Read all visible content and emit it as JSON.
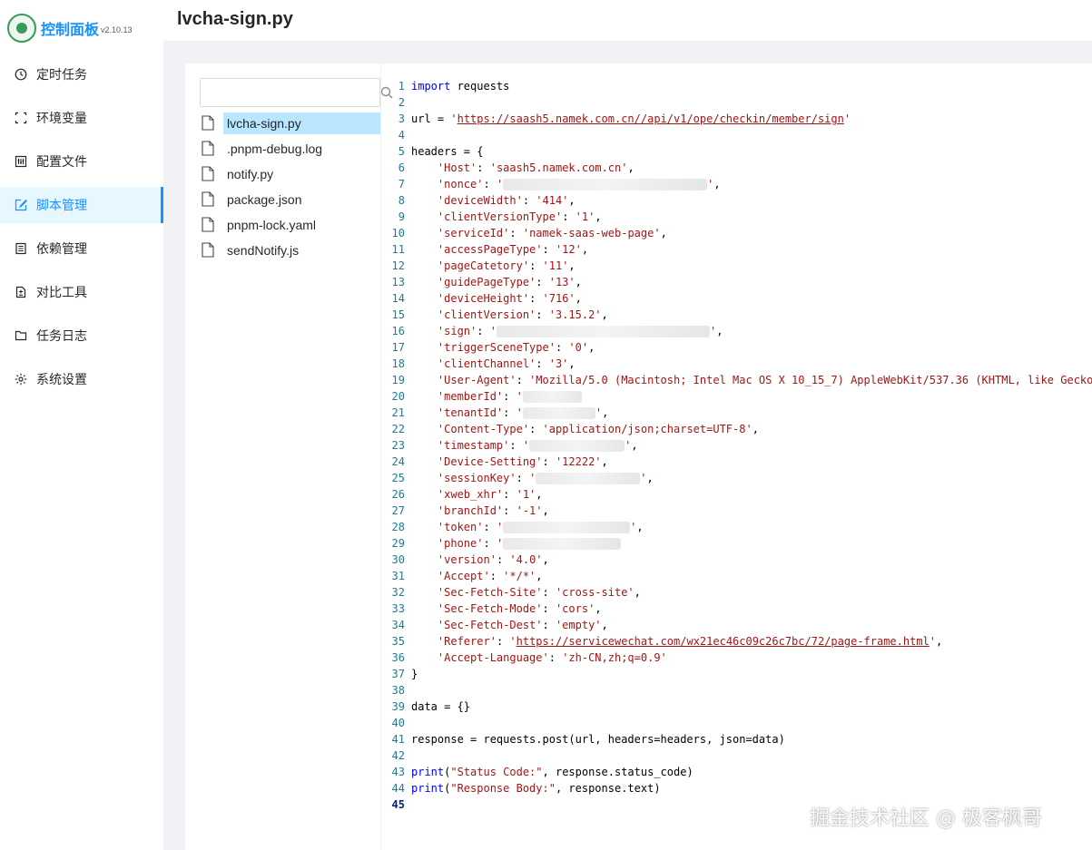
{
  "app": {
    "title": "控制面板",
    "version": "v2.10.13"
  },
  "page": {
    "title": "lvcha-sign.py"
  },
  "sidebar": {
    "items": [
      {
        "label": "定时任务",
        "icon": "clock-icon",
        "active": false
      },
      {
        "label": "环境变量",
        "icon": "variable-icon",
        "active": false
      },
      {
        "label": "配置文件",
        "icon": "control-icon",
        "active": false
      },
      {
        "label": "脚本管理",
        "icon": "form-edit-icon",
        "active": true
      },
      {
        "label": "依赖管理",
        "icon": "container-icon",
        "active": false
      },
      {
        "label": "对比工具",
        "icon": "diff-icon",
        "active": false
      },
      {
        "label": "任务日志",
        "icon": "folder-icon",
        "active": false
      },
      {
        "label": "系统设置",
        "icon": "gear-icon",
        "active": false
      }
    ]
  },
  "search": {
    "placeholder": "",
    "value": ""
  },
  "files": [
    {
      "name": "lvcha-sign.py",
      "selected": true
    },
    {
      "name": ".pnpm-debug.log",
      "selected": false
    },
    {
      "name": "notify.py",
      "selected": false
    },
    {
      "name": "package.json",
      "selected": false
    },
    {
      "name": "pnpm-lock.yaml",
      "selected": false
    },
    {
      "name": "sendNotify.js",
      "selected": false
    }
  ],
  "editor": {
    "current_line": 45,
    "lines": [
      [
        [
          "kw",
          "import"
        ],
        [
          "t",
          " requests"
        ]
      ],
      [],
      [
        [
          "t",
          "url = "
        ],
        [
          "s",
          "'"
        ],
        [
          "u",
          "https://saash5.namek.com.cn//api/v1/ope/checkin/member/sign"
        ],
        [
          "s",
          "'"
        ]
      ],
      [],
      [
        [
          "t",
          "headers = {"
        ]
      ],
      [
        [
          "t",
          "    "
        ],
        [
          "s",
          "'Host'"
        ],
        [
          "t",
          ": "
        ],
        [
          "s",
          "'saash5.namek.com.cn'"
        ],
        [
          "t",
          ","
        ]
      ],
      [
        [
          "t",
          "    "
        ],
        [
          "s",
          "'nonce'"
        ],
        [
          "t",
          ": "
        ],
        [
          "s",
          "'"
        ],
        [
          "b",
          ""
        ],
        [
          "s",
          "'"
        ],
        [
          "t",
          ","
        ]
      ],
      [
        [
          "t",
          "    "
        ],
        [
          "s",
          "'deviceWidth'"
        ],
        [
          "t",
          ": "
        ],
        [
          "s",
          "'414'"
        ],
        [
          "t",
          ","
        ]
      ],
      [
        [
          "t",
          "    "
        ],
        [
          "s",
          "'clientVersionType'"
        ],
        [
          "t",
          ": "
        ],
        [
          "s",
          "'1'"
        ],
        [
          "t",
          ","
        ]
      ],
      [
        [
          "t",
          "    "
        ],
        [
          "s",
          "'serviceId'"
        ],
        [
          "t",
          ": "
        ],
        [
          "s",
          "'namek-saas-web-page'"
        ],
        [
          "t",
          ","
        ]
      ],
      [
        [
          "t",
          "    "
        ],
        [
          "s",
          "'accessPageType'"
        ],
        [
          "t",
          ": "
        ],
        [
          "s",
          "'12'"
        ],
        [
          "t",
          ","
        ]
      ],
      [
        [
          "t",
          "    "
        ],
        [
          "s",
          "'pageCatetory'"
        ],
        [
          "t",
          ": "
        ],
        [
          "s",
          "'11'"
        ],
        [
          "t",
          ","
        ]
      ],
      [
        [
          "t",
          "    "
        ],
        [
          "s",
          "'guidePageType'"
        ],
        [
          "t",
          ": "
        ],
        [
          "s",
          "'13'"
        ],
        [
          "t",
          ","
        ]
      ],
      [
        [
          "t",
          "    "
        ],
        [
          "s",
          "'deviceHeight'"
        ],
        [
          "t",
          ": "
        ],
        [
          "s",
          "'716'"
        ],
        [
          "t",
          ","
        ]
      ],
      [
        [
          "t",
          "    "
        ],
        [
          "s",
          "'clientVersion'"
        ],
        [
          "t",
          ": "
        ],
        [
          "s",
          "'3.15.2'"
        ],
        [
          "t",
          ","
        ]
      ],
      [
        [
          "t",
          "    "
        ],
        [
          "s",
          "'sign'"
        ],
        [
          "t",
          ": "
        ],
        [
          "s",
          "'"
        ],
        [
          "b",
          ""
        ],
        [
          "s",
          "'"
        ],
        [
          "t",
          ","
        ]
      ],
      [
        [
          "t",
          "    "
        ],
        [
          "s",
          "'triggerSceneType'"
        ],
        [
          "t",
          ": "
        ],
        [
          "s",
          "'0'"
        ],
        [
          "t",
          ","
        ]
      ],
      [
        [
          "t",
          "    "
        ],
        [
          "s",
          "'clientChannel'"
        ],
        [
          "t",
          ": "
        ],
        [
          "s",
          "'3'"
        ],
        [
          "t",
          ","
        ]
      ],
      [
        [
          "t",
          "    "
        ],
        [
          "s",
          "'User-Agent'"
        ],
        [
          "t",
          ": "
        ],
        [
          "s",
          "'Mozilla/5.0 (Macintosh; Intel Mac OS X 10_15_7) AppleWebKit/537.36 (KHTML, like Gecko"
        ]
      ],
      [
        [
          "t",
          "    "
        ],
        [
          "s",
          "'memberId'"
        ],
        [
          "t",
          ": "
        ],
        [
          "s",
          "'"
        ],
        [
          "b",
          ""
        ]
      ],
      [
        [
          "t",
          "    "
        ],
        [
          "s",
          "'tenantId'"
        ],
        [
          "t",
          ": "
        ],
        [
          "s",
          "'"
        ],
        [
          "b",
          ""
        ],
        [
          "s",
          "'"
        ],
        [
          "t",
          ","
        ]
      ],
      [
        [
          "t",
          "    "
        ],
        [
          "s",
          "'Content-Type'"
        ],
        [
          "t",
          ": "
        ],
        [
          "s",
          "'application/json;charset=UTF-8'"
        ],
        [
          "t",
          ","
        ]
      ],
      [
        [
          "t",
          "    "
        ],
        [
          "s",
          "'timestamp'"
        ],
        [
          "t",
          ": "
        ],
        [
          "s",
          "'"
        ],
        [
          "b",
          ""
        ],
        [
          "s",
          "'"
        ],
        [
          "t",
          ","
        ]
      ],
      [
        [
          "t",
          "    "
        ],
        [
          "s",
          "'Device-Setting'"
        ],
        [
          "t",
          ": "
        ],
        [
          "s",
          "'12222'"
        ],
        [
          "t",
          ","
        ]
      ],
      [
        [
          "t",
          "    "
        ],
        [
          "s",
          "'sessionKey'"
        ],
        [
          "t",
          ": "
        ],
        [
          "s",
          "'"
        ],
        [
          "b",
          ""
        ],
        [
          "s",
          "'"
        ],
        [
          "t",
          ","
        ]
      ],
      [
        [
          "t",
          "    "
        ],
        [
          "s",
          "'xweb_xhr'"
        ],
        [
          "t",
          ": "
        ],
        [
          "s",
          "'1'"
        ],
        [
          "t",
          ","
        ]
      ],
      [
        [
          "t",
          "    "
        ],
        [
          "s",
          "'branchId'"
        ],
        [
          "t",
          ": "
        ],
        [
          "s",
          "'-1'"
        ],
        [
          "t",
          ","
        ]
      ],
      [
        [
          "t",
          "    "
        ],
        [
          "s",
          "'token'"
        ],
        [
          "t",
          ": "
        ],
        [
          "s",
          "'"
        ],
        [
          "b",
          ""
        ],
        [
          "s",
          "'"
        ],
        [
          "t",
          ","
        ]
      ],
      [
        [
          "t",
          "    "
        ],
        [
          "s",
          "'phone'"
        ],
        [
          "t",
          ": "
        ],
        [
          "s",
          "'"
        ],
        [
          "b",
          ""
        ]
      ],
      [
        [
          "t",
          "    "
        ],
        [
          "s",
          "'version'"
        ],
        [
          "t",
          ": "
        ],
        [
          "s",
          "'4.0'"
        ],
        [
          "t",
          ","
        ]
      ],
      [
        [
          "t",
          "    "
        ],
        [
          "s",
          "'Accept'"
        ],
        [
          "t",
          ": "
        ],
        [
          "s",
          "'*/*'"
        ],
        [
          "t",
          ","
        ]
      ],
      [
        [
          "t",
          "    "
        ],
        [
          "s",
          "'Sec-Fetch-Site'"
        ],
        [
          "t",
          ": "
        ],
        [
          "s",
          "'cross-site'"
        ],
        [
          "t",
          ","
        ]
      ],
      [
        [
          "t",
          "    "
        ],
        [
          "s",
          "'Sec-Fetch-Mode'"
        ],
        [
          "t",
          ": "
        ],
        [
          "s",
          "'cors'"
        ],
        [
          "t",
          ","
        ]
      ],
      [
        [
          "t",
          "    "
        ],
        [
          "s",
          "'Sec-Fetch-Dest'"
        ],
        [
          "t",
          ": "
        ],
        [
          "s",
          "'empty'"
        ],
        [
          "t",
          ","
        ]
      ],
      [
        [
          "t",
          "    "
        ],
        [
          "s",
          "'Referer'"
        ],
        [
          "t",
          ": "
        ],
        [
          "s",
          "'"
        ],
        [
          "u",
          "https://servicewechat.com/wx21ec46c09c26c7bc/72/page-frame.html"
        ],
        [
          "s",
          "'"
        ],
        [
          "t",
          ","
        ]
      ],
      [
        [
          "t",
          "    "
        ],
        [
          "s",
          "'Accept-Language'"
        ],
        [
          "t",
          ": "
        ],
        [
          "s",
          "'zh-CN,zh;q=0.9'"
        ]
      ],
      [
        [
          "t",
          "}"
        ]
      ],
      [],
      [
        [
          "t",
          "data = {}"
        ]
      ],
      [],
      [
        [
          "t",
          "response = requests.post(url, headers=headers, json=data)"
        ]
      ],
      [],
      [
        [
          "kw",
          "print"
        ],
        [
          "t",
          "("
        ],
        [
          "s",
          "\"Status Code:\""
        ],
        [
          "t",
          ", response.status_code)"
        ]
      ],
      [
        [
          "kw",
          "print"
        ],
        [
          "t",
          "("
        ],
        [
          "s",
          "\"Response Body:\""
        ],
        [
          "t",
          ", response.text)"
        ]
      ],
      []
    ]
  },
  "watermark": "掘金技术社区 @ 极客枫哥",
  "colors": {
    "accent": "#1890ff",
    "active_bg": "#e6f7ff",
    "selected_file_bg": "#bae7ff",
    "keyword": "#0000ff",
    "string": "#a31515",
    "line_number": "#237893"
  }
}
